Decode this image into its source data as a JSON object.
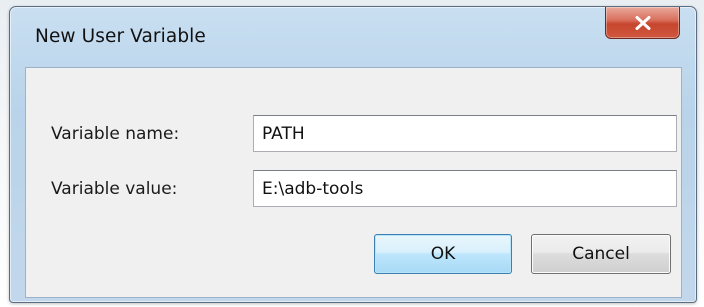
{
  "window": {
    "title": "New User Variable",
    "close_icon": "close-icon"
  },
  "form": {
    "name_label": "Variable name:",
    "name_value": "PATH",
    "value_label": "Variable value:",
    "value_value": "E:\\adb-tools"
  },
  "buttons": {
    "ok_label": "OK",
    "cancel_label": "Cancel"
  },
  "colors": {
    "close_button": "#c7452d",
    "ok_button_border": "#3c7fb1",
    "frame": "#b9d3ea",
    "client_background": "#f0f0f0"
  }
}
